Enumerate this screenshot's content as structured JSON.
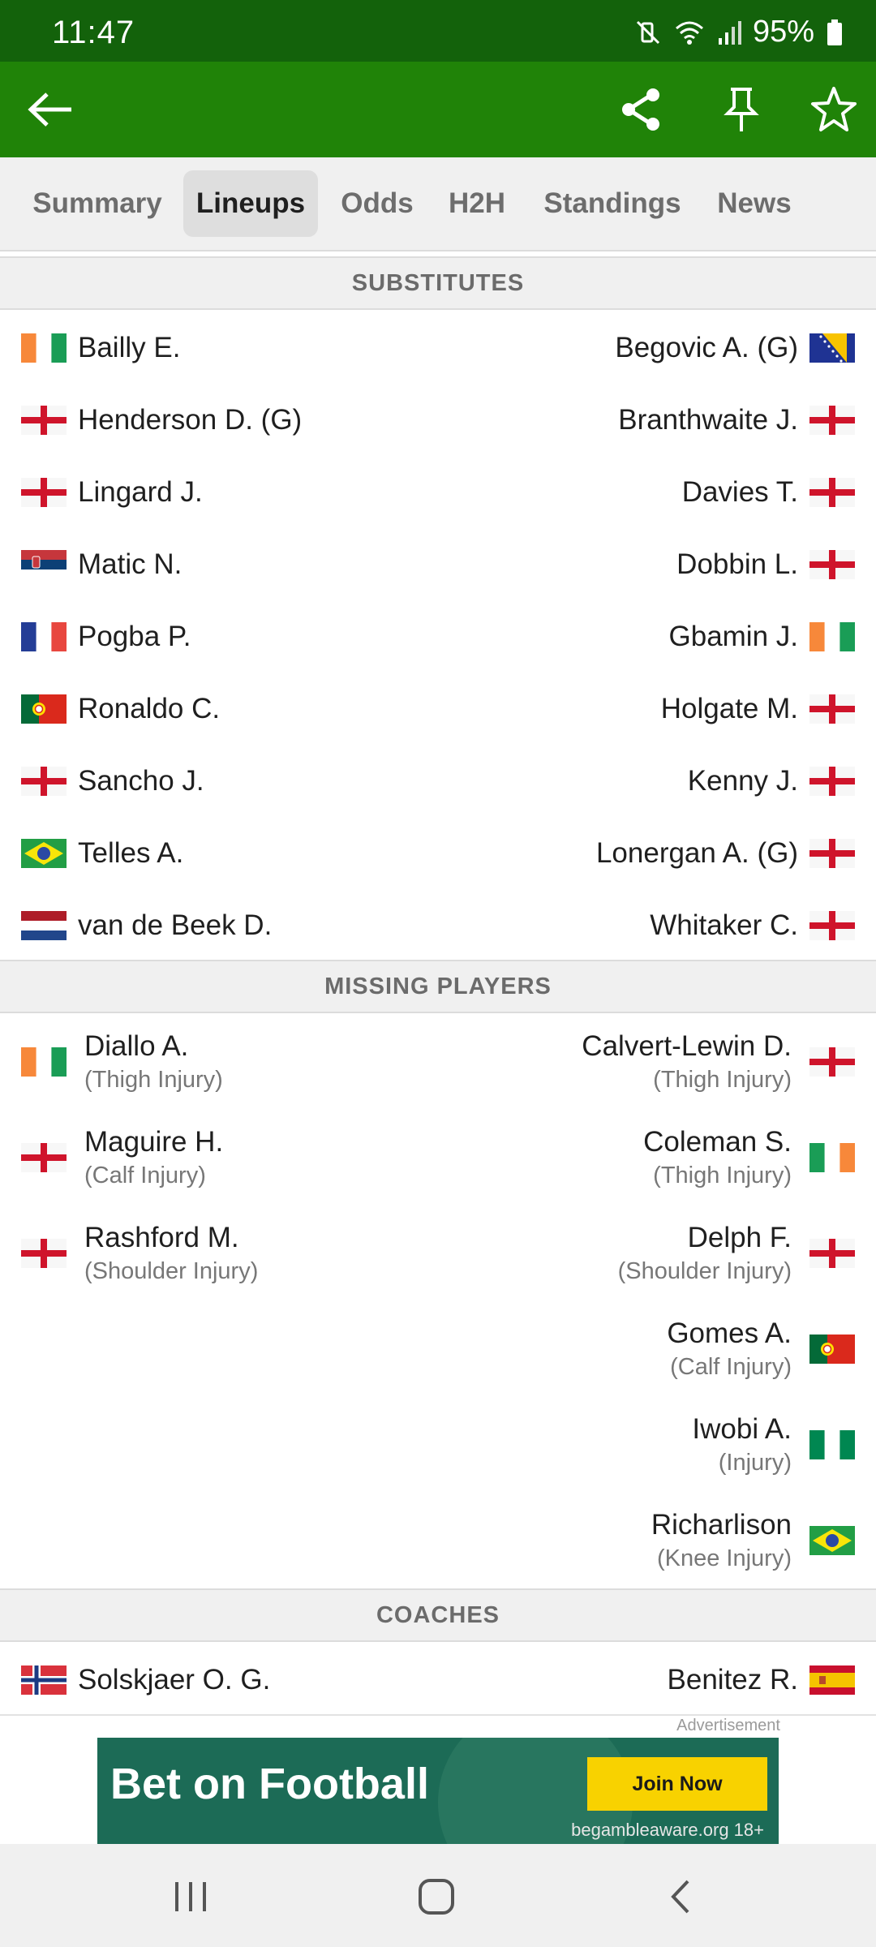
{
  "status_bar": {
    "time": "11:47",
    "battery": "95%",
    "icons": [
      "mute-vibrate-icon",
      "wifi-icon",
      "signal-icon",
      "battery-icon"
    ]
  },
  "app_bar": {
    "icons": [
      "back-arrow-icon",
      "share-icon",
      "pin-icon",
      "star-icon"
    ]
  },
  "tabs": [
    {
      "label": "Summary",
      "active": false
    },
    {
      "label": "Lineups",
      "active": true
    },
    {
      "label": "Odds",
      "active": false
    },
    {
      "label": "H2H",
      "active": false
    },
    {
      "label": "Standings",
      "active": false
    },
    {
      "label": "News",
      "active": false
    }
  ],
  "substitutes": {
    "title": "SUBSTITUTES",
    "rows": [
      {
        "home": {
          "name": "Bailly E.",
          "flag": "ivory-coast"
        },
        "away": {
          "name": "Begovic A. (G)",
          "flag": "bosnia"
        }
      },
      {
        "home": {
          "name": "Henderson D. (G)",
          "flag": "england"
        },
        "away": {
          "name": "Branthwaite J.",
          "flag": "england"
        }
      },
      {
        "home": {
          "name": "Lingard J.",
          "flag": "england"
        },
        "away": {
          "name": "Davies T.",
          "flag": "england"
        }
      },
      {
        "home": {
          "name": "Matic N.",
          "flag": "serbia"
        },
        "away": {
          "name": "Dobbin L.",
          "flag": "england"
        }
      },
      {
        "home": {
          "name": "Pogba P.",
          "flag": "france"
        },
        "away": {
          "name": "Gbamin J.",
          "flag": "ivory-coast"
        }
      },
      {
        "home": {
          "name": "Ronaldo C.",
          "flag": "portugal"
        },
        "away": {
          "name": "Holgate M.",
          "flag": "england"
        }
      },
      {
        "home": {
          "name": "Sancho J.",
          "flag": "england"
        },
        "away": {
          "name": "Kenny J.",
          "flag": "england"
        }
      },
      {
        "home": {
          "name": "Telles A.",
          "flag": "brazil"
        },
        "away": {
          "name": "Lonergan A. (G)",
          "flag": "england"
        }
      },
      {
        "home": {
          "name": "van de Beek D.",
          "flag": "netherlands"
        },
        "away": {
          "name": "Whitaker C.",
          "flag": "england"
        }
      }
    ]
  },
  "missing_players": {
    "title": "MISSING PLAYERS",
    "rows": [
      {
        "home": {
          "name": "Diallo A.",
          "reason": "(Thigh Injury)",
          "flag": "ivory-coast"
        },
        "away": {
          "name": "Calvert-Lewin D.",
          "reason": "(Thigh Injury)",
          "flag": "england"
        }
      },
      {
        "home": {
          "name": "Maguire H.",
          "reason": "(Calf Injury)",
          "flag": "england"
        },
        "away": {
          "name": "Coleman S.",
          "reason": "(Thigh Injury)",
          "flag": "ireland"
        }
      },
      {
        "home": {
          "name": "Rashford M.",
          "reason": "(Shoulder Injury)",
          "flag": "england"
        },
        "away": {
          "name": "Delph F.",
          "reason": "(Shoulder Injury)",
          "flag": "england"
        }
      },
      {
        "home": null,
        "away": {
          "name": "Gomes A.",
          "reason": "(Calf Injury)",
          "flag": "portugal"
        }
      },
      {
        "home": null,
        "away": {
          "name": "Iwobi A.",
          "reason": "(Injury)",
          "flag": "nigeria"
        }
      },
      {
        "home": null,
        "away": {
          "name": "Richarlison",
          "reason": "(Knee Injury)",
          "flag": "brazil"
        }
      }
    ]
  },
  "coaches": {
    "title": "COACHES",
    "home": {
      "name": "Solskjaer O. G.",
      "flag": "norway"
    },
    "away": {
      "name": "Benitez R.",
      "flag": "spain"
    }
  },
  "ad": {
    "label": "Advertisement",
    "title": "Bet on Football",
    "button": "Join Now",
    "footer": "begambleaware.org  18+"
  },
  "nav_bar": {
    "icons": [
      "recent-apps-icon",
      "home-icon",
      "back-icon"
    ]
  }
}
